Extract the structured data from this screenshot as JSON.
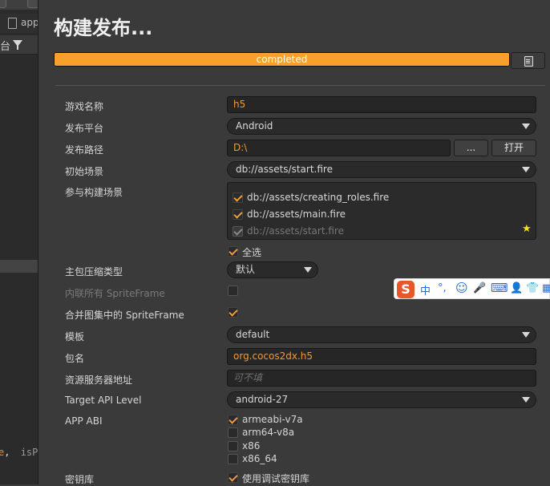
{
  "editor": {
    "tab_name": "app",
    "glyph": "台",
    "code": {
      "part1": "e",
      "part2": ",",
      "part3": "isP"
    }
  },
  "panel": {
    "title": "构建发布...",
    "progress": {
      "text": "completed",
      "percent": 100
    }
  },
  "form": {
    "game_name": {
      "label": "游戏名称",
      "value": "h5"
    },
    "platform": {
      "label": "发布平台",
      "value": "Android"
    },
    "path": {
      "label": "发布路径",
      "value": "D:\\",
      "browse_label": "...",
      "open_label": "打开"
    },
    "start_scene": {
      "label": "初始场景",
      "value": "db://assets/start.fire"
    },
    "build_scenes": {
      "label": "参与构建场景",
      "items": [
        {
          "label": "db://assets/creating_roles.fire",
          "checked": true
        },
        {
          "label": "db://assets/main.fire",
          "checked": true
        },
        {
          "label": "db://assets/start.fire",
          "checked": true
        }
      ],
      "select_all_label": "全选"
    },
    "compression": {
      "label": "主包压缩类型",
      "value": "默认"
    },
    "inline_spriteframe": {
      "label": "内联所有 SpriteFrame",
      "checked": false
    },
    "merge_spriteframe": {
      "label": "合并图集中的 SpriteFrame",
      "checked": true
    },
    "template": {
      "label": "模板",
      "value": "default"
    },
    "package_name": {
      "label": "包名",
      "value": "org.cocos2dx.h5"
    },
    "asset_server": {
      "label": "资源服务器地址",
      "placeholder": "可不填"
    },
    "target_api": {
      "label": "Target API Level",
      "value": "android-27"
    },
    "app_abi": {
      "label": "APP ABI",
      "items": [
        {
          "label": "armeabi-v7a",
          "checked": true
        },
        {
          "label": "arm64-v8a",
          "checked": false
        },
        {
          "label": "x86",
          "checked": false
        },
        {
          "label": "x86_64",
          "checked": false
        }
      ]
    },
    "keystore": {
      "label": "密钥库",
      "checkbox_label": "使用调试密钥库",
      "checked": true
    }
  },
  "ime": {
    "logo": "S",
    "mode": "中",
    "punct": "°,",
    "emoji": "☺",
    "mic": "🎤",
    "keyboard": "⌨",
    "user": "👤",
    "shirt": "👕",
    "grid": "▦"
  },
  "colors": {
    "accent": "#f29a36",
    "progress": "#f7a02c",
    "panel_bg": "#3a3a3a",
    "field_bg": "#262626"
  }
}
